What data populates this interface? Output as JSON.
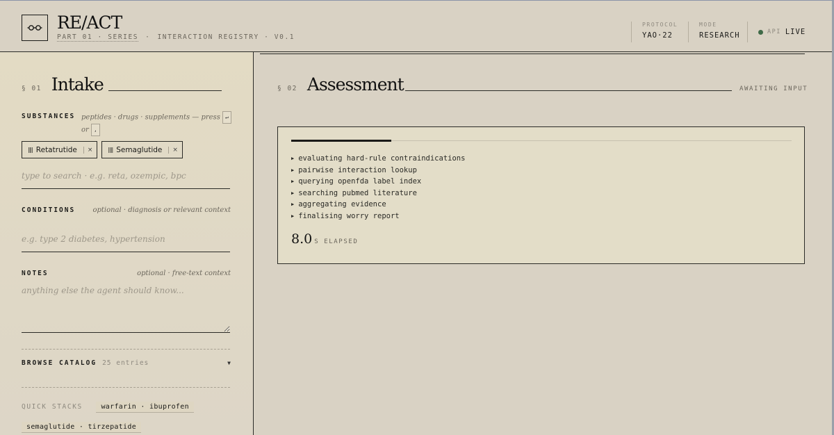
{
  "header": {
    "brand": "RE/ACT",
    "part": "PART 01 · SERIES",
    "separator": "·",
    "registry": "INTERACTION REGISTRY · V0.1",
    "protocol_label": "PROTOCOL",
    "protocol_value": "YAO·22",
    "mode_label": "MODE",
    "mode_value": "RESEARCH",
    "api_label": "API",
    "api_value": "LIVE",
    "api_status_color": "#3f6a47"
  },
  "intake": {
    "section_num": "§ 01",
    "title": "Intake",
    "substances_label": "SUBSTANCES",
    "substances_hint": "peptides · drugs · supplements — press",
    "hint_or": "or",
    "key_enter": "↵",
    "key_comma": ",",
    "chips": [
      {
        "name": "Retatrutide",
        "remove": "×"
      },
      {
        "name": "Semaglutide",
        "remove": "×"
      }
    ],
    "search_placeholder": "type to search · e.g. reta, ozempic, bpc",
    "conditions_label": "CONDITIONS",
    "conditions_hint": "optional · diagnosis or relevant context",
    "conditions_placeholder": "e.g. type 2 diabetes, hypertension",
    "notes_label": "NOTES",
    "notes_hint": "optional · free-text context",
    "notes_placeholder": "anything else the agent should know...",
    "catalog_label": "BROWSE CATALOG",
    "catalog_count": "25 entries",
    "quick_stacks_label": "QUICK STACKS",
    "quick_stacks": [
      "warfarin · ibuprofen",
      "semaglutide · tirzepatide"
    ]
  },
  "assessment": {
    "section_num": "§ 02",
    "title": "Assessment",
    "status": "AWAITING INPUT",
    "progress": 0.2,
    "steps": [
      "evaluating hard-rule contraindications",
      "pairwise interaction lookup",
      "querying openfda label index",
      "searching pubmed literature",
      "aggregating evidence",
      "finalising worry report"
    ],
    "elapsed_value": "8.0",
    "elapsed_unit": "S ELAPSED"
  }
}
